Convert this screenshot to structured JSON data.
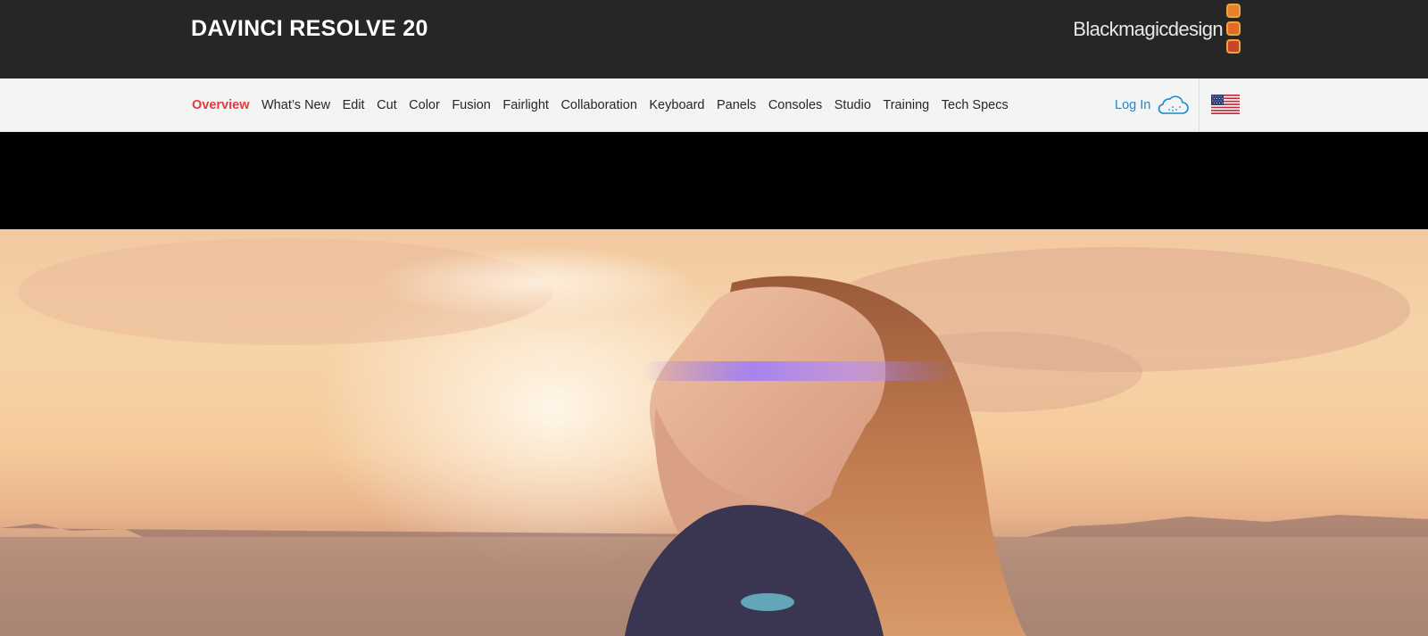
{
  "header": {
    "product_title": "DAVINCI RESOLVE 20",
    "brand_name": "Blackmagicdesign",
    "brand_colors": [
      "#e5802d",
      "#e06a26",
      "#c9452a"
    ]
  },
  "nav": {
    "items": [
      {
        "label": "Overview",
        "active": true
      },
      {
        "label": "What’s New",
        "active": false
      },
      {
        "label": "Edit",
        "active": false
      },
      {
        "label": "Cut",
        "active": false
      },
      {
        "label": "Color",
        "active": false
      },
      {
        "label": "Fusion",
        "active": false
      },
      {
        "label": "Fairlight",
        "active": false
      },
      {
        "label": "Collaboration",
        "active": false
      },
      {
        "label": "Keyboard",
        "active": false
      },
      {
        "label": "Panels",
        "active": false
      },
      {
        "label": "Consoles",
        "active": false
      },
      {
        "label": "Studio",
        "active": false
      },
      {
        "label": "Training",
        "active": false
      },
      {
        "label": "Tech Specs",
        "active": false
      }
    ],
    "login_label": "Log In",
    "login_icon": "cloud-icon",
    "region_icon": "us-flag-icon",
    "active_color": "#e8383d",
    "link_color": "#1d87d0"
  },
  "hero": {
    "image": "woman-at-sunset-photo"
  }
}
